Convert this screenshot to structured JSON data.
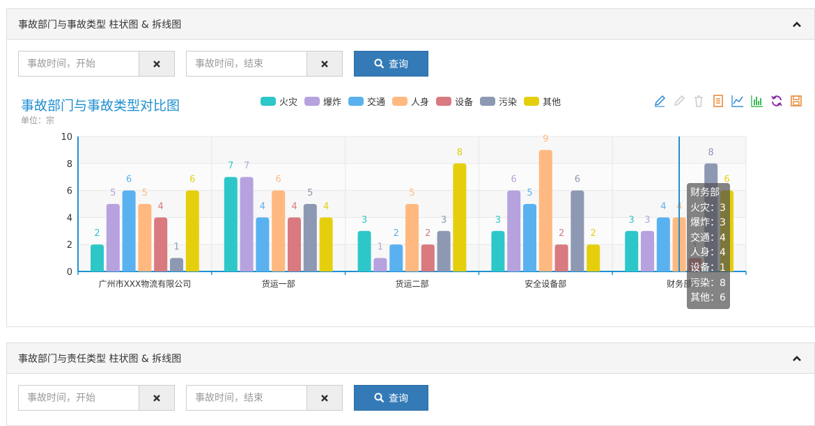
{
  "panel1": {
    "title": "事故部门与事故类型 柱状图 & 拆线图",
    "start_placeholder": "事故时间，开始",
    "end_placeholder": "事故时间，结束",
    "query_label": "查询",
    "chart_title": "事故部门与事故类型对比图",
    "chart_subtitle": "单位：宗"
  },
  "panel2": {
    "title": "事故部门与责任类型 柱状图 & 拆线图",
    "start_placeholder": "事故时间，开始",
    "end_placeholder": "事故时间，结束",
    "query_label": "查询"
  },
  "toolbox": [
    "pencil-icon",
    "eraser-icon",
    "trash-icon",
    "data-view-icon",
    "line-chart-icon",
    "bar-chart-icon",
    "refresh-icon",
    "save-icon"
  ],
  "tooltip": {
    "title": "财务部",
    "lines": [
      "火灾：3",
      "爆炸：3",
      "交通：4",
      "人身：4",
      "设备：1",
      "污染：8",
      "其他：6"
    ]
  },
  "chart_data": {
    "type": "bar",
    "title": "事故部门与事故类型对比图",
    "subtitle": "单位：宗",
    "categories": [
      "广州市XXX物流有限公司",
      "货运一部",
      "货运二部",
      "安全设备部",
      "财务部"
    ],
    "ylim": [
      0,
      10
    ],
    "yticks": [
      0,
      2,
      4,
      6,
      8,
      10
    ],
    "grid": true,
    "legend_position": "top",
    "series": [
      {
        "name": "火灾",
        "color": "#2ec7c9",
        "values": [
          2,
          7,
          3,
          3,
          3
        ]
      },
      {
        "name": "爆炸",
        "color": "#b6a2de",
        "values": [
          5,
          7,
          1,
          6,
          3
        ]
      },
      {
        "name": "交通",
        "color": "#5ab1ef",
        "values": [
          6,
          4,
          2,
          5,
          4
        ]
      },
      {
        "name": "人身",
        "color": "#ffb980",
        "values": [
          5,
          6,
          5,
          9,
          4
        ]
      },
      {
        "name": "设备",
        "color": "#d87a80",
        "values": [
          4,
          4,
          2,
          2,
          1
        ]
      },
      {
        "name": "污染",
        "color": "#8d98b3",
        "values": [
          1,
          5,
          3,
          6,
          8
        ]
      },
      {
        "name": "其他",
        "color": "#e5cf0d",
        "values": [
          6,
          4,
          8,
          2,
          6
        ]
      }
    ]
  }
}
